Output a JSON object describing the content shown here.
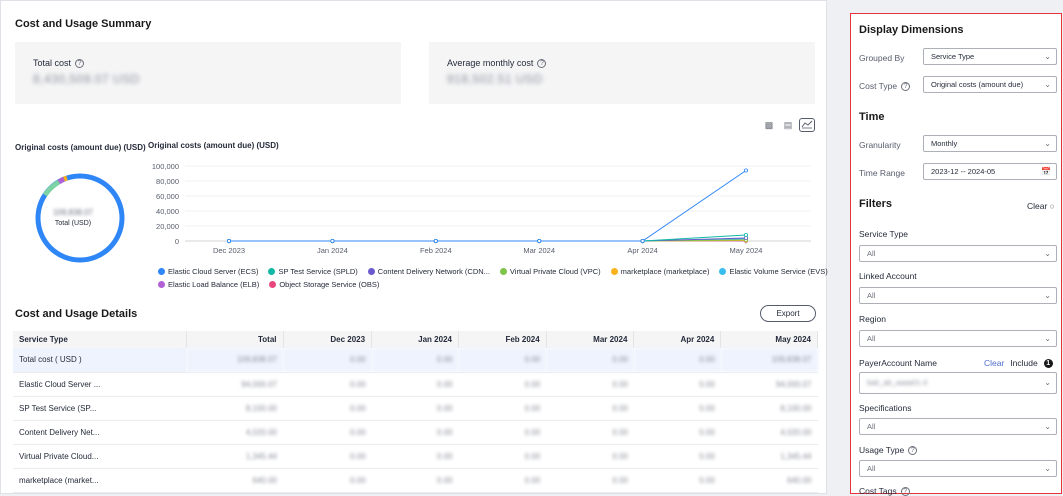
{
  "summary": {
    "title": "Cost and Usage Summary",
    "total_cost_label": "Total cost",
    "total_cost_value": "8,430,509.07 USD",
    "avg_cost_label": "Average monthly cost",
    "avg_cost_value": "918,502.51 USD"
  },
  "ring": {
    "title": "Original costs (amount due) (USD)",
    "value": "109,838.07",
    "caption": "Total (USD)"
  },
  "trend": {
    "title": "Original costs (amount due)  (USD)"
  },
  "chart_data": {
    "type": "line",
    "categories": [
      "Dec 2023",
      "Jan 2024",
      "Feb 2024",
      "Mar 2024",
      "Apr 2024",
      "May 2024"
    ],
    "ylim": [
      0,
      100000
    ],
    "yticks": [
      "100,000",
      "80,000",
      "60,000",
      "40,000",
      "20,000",
      "0"
    ],
    "grid": true,
    "legend_position": "bottom",
    "series": [
      {
        "name": "Elastic Cloud Server (ECS)",
        "color": "#2f86f6",
        "values": [
          0,
          0,
          0,
          0,
          0,
          94000
        ]
      },
      {
        "name": "SP Test Service (SPLD)",
        "color": "#11b8a6",
        "values": [
          0,
          0,
          0,
          0,
          0,
          8000
        ]
      },
      {
        "name": "Content Delivery Network (CDN...",
        "color": "#6a5acd",
        "values": [
          0,
          0,
          0,
          0,
          0,
          4000
        ]
      },
      {
        "name": "Virtual Private Cloud (VPC)",
        "color": "#7ec34a",
        "values": [
          0,
          0,
          0,
          0,
          0,
          1500
        ]
      },
      {
        "name": "marketplace (marketplace)",
        "color": "#f9b11c",
        "values": [
          0,
          0,
          0,
          0,
          0,
          600
        ]
      },
      {
        "name": "Elastic Volume Service (EVS)",
        "color": "#38bdf0",
        "values": [
          0,
          0,
          0,
          0,
          0,
          3000
        ]
      },
      {
        "name": "Elastic Load Balance (ELB)",
        "color": "#b161d4",
        "values": [
          0,
          0,
          0,
          0,
          0,
          300
        ]
      },
      {
        "name": "Object Storage Service (OBS)",
        "color": "#e8477d",
        "values": [
          0,
          0,
          0,
          0,
          0,
          200
        ]
      }
    ]
  },
  "details": {
    "title": "Cost and Usage Details",
    "export_label": "Export",
    "columns": [
      "Service Type",
      "Total",
      "Dec 2023",
      "Jan 2024",
      "Feb 2024",
      "Mar 2024",
      "Apr 2024",
      "May 2024"
    ],
    "rows": [
      [
        "Total cost ( USD )",
        "109,838.07",
        "0.00",
        "0.00",
        "0.00",
        "0.00",
        "0.00",
        "109,838.07"
      ],
      [
        "Elastic Cloud Server ...",
        "94,000.07",
        "0.00",
        "0.00",
        "0.00",
        "0.00",
        "0.00",
        "94,000.07"
      ],
      [
        "SP Test Service (SP...",
        "8,100.00",
        "0.00",
        "0.00",
        "0.00",
        "0.00",
        "0.00",
        "8,100.00"
      ],
      [
        "Content Delivery Net...",
        "4,020.00",
        "0.00",
        "0.00",
        "0.00",
        "0.00",
        "0.00",
        "4,020.00"
      ],
      [
        "Virtual Private Cloud...",
        "1,345.44",
        "0.00",
        "0.00",
        "0.00",
        "0.00",
        "0.00",
        "1,345.44"
      ],
      [
        "marketplace (market...",
        "640.00",
        "0.00",
        "0.00",
        "0.00",
        "0.00",
        "0.00",
        "640.00"
      ]
    ]
  },
  "panel": {
    "display_dimensions": "Display Dimensions",
    "grouped_by_label": "Grouped By",
    "grouped_by_value": "Service Type",
    "cost_type_label": "Cost Type",
    "cost_type_value": "Original costs (amount due)",
    "time_title": "Time",
    "granularity_label": "Granularity",
    "granularity_value": "Monthly",
    "time_range_label": "Time Range",
    "time_range_value": "2023-12 -- 2024-05",
    "filters_title": "Filters",
    "clear_label": "Clear",
    "service_type_label": "Service Type",
    "service_type_value": "All",
    "linked_account_label": "Linked Account",
    "linked_account_value": "All",
    "region_label": "Region",
    "region_value": "All",
    "payer_account_label": "PayerAccount Name",
    "payer_clear": "Clear",
    "payer_include": "Include",
    "payer_value": "bak_ab_aaaa01  d",
    "specifications_label": "Specifications",
    "specifications_value": "All",
    "usage_type_label": "Usage Type",
    "usage_type_value": "All",
    "cost_tags_label": "Cost Tags"
  }
}
